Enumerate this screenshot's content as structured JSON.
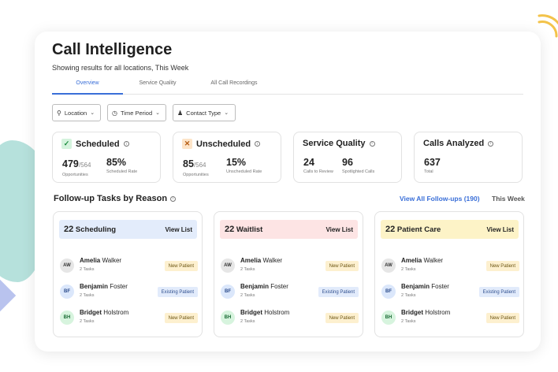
{
  "header": {
    "title": "Call Intelligence",
    "subtitle": "Showing results for all locations, This Week"
  },
  "tabs": [
    {
      "label": "Overview",
      "active": true
    },
    {
      "label": "Service Quality",
      "active": false
    },
    {
      "label": "All Call Recordings",
      "active": false
    }
  ],
  "filters": [
    {
      "label": "Location",
      "icon": "location-pin-icon"
    },
    {
      "label": "Time Period",
      "icon": "clock-icon"
    },
    {
      "label": "Contact Type",
      "icon": "contacts-icon"
    }
  ],
  "stats": {
    "scheduled": {
      "title": "Scheduled",
      "m1_value": "479",
      "m1_denom": "/564",
      "m1_label": "Opportunities",
      "m2_value": "85%",
      "m2_label": "Scheduled Rate"
    },
    "unscheduled": {
      "title": "Unscheduled",
      "m1_value": "85",
      "m1_denom": "/564",
      "m1_label": "Opportunities",
      "m2_value": "15%",
      "m2_label": "Unscheduled Rate"
    },
    "service_quality": {
      "title": "Service Quality",
      "m1_value": "24",
      "m1_label": "Calls to Review",
      "m2_value": "96",
      "m2_label": "Spotlighted Calls"
    },
    "calls_analyzed": {
      "title": "Calls Analyzed",
      "m1_value": "637",
      "m1_label": "Total"
    }
  },
  "followup": {
    "title": "Follow-up Tasks by Reason",
    "view_all": "View All Follow-ups (190)",
    "period": "This Week"
  },
  "task_cards": [
    {
      "count": "22",
      "reason": "Scheduling",
      "view": "View List",
      "color": "#e3ecfb",
      "people": [
        {
          "initials": "AW",
          "first": "Amelia",
          "last": "Walker",
          "tasks": "2 Tasks",
          "badge": "New Patient"
        },
        {
          "initials": "BF",
          "first": "Benjamin",
          "last": "Foster",
          "tasks": "2 Tasks",
          "badge": "Existing Patient"
        },
        {
          "initials": "BH",
          "first": "Bridget",
          "last": "Holstrom",
          "tasks": "2 Tasks",
          "badge": "New Patient"
        }
      ]
    },
    {
      "count": "22",
      "reason": "Waitlist",
      "view": "View List",
      "color": "#fde4e4",
      "people": [
        {
          "initials": "AW",
          "first": "Amelia",
          "last": "Walker",
          "tasks": "2 Tasks",
          "badge": "New Patient"
        },
        {
          "initials": "BF",
          "first": "Benjamin",
          "last": "Foster",
          "tasks": "2 Tasks",
          "badge": "Existing Patient"
        },
        {
          "initials": "BH",
          "first": "Bridget",
          "last": "Holstrom",
          "tasks": "2 Tasks",
          "badge": "New Patient"
        }
      ]
    },
    {
      "count": "22",
      "reason": "Patient Care",
      "view": "View List",
      "color": "#fdf3c7",
      "people": [
        {
          "initials": "AW",
          "first": "Amelia",
          "last": "Walker",
          "tasks": "2 Tasks",
          "badge": "New Patient"
        },
        {
          "initials": "BF",
          "first": "Benjamin",
          "last": "Foster",
          "tasks": "2 Tasks",
          "badge": "Existing Patient"
        },
        {
          "initials": "BH",
          "first": "Bridget",
          "last": "Holstrom",
          "tasks": "2 Tasks",
          "badge": "New Patient"
        }
      ]
    }
  ],
  "colors": {
    "accent": "#3a6fd8",
    "scheduled": "#1a8a3c",
    "unscheduled": "#b45a10"
  }
}
